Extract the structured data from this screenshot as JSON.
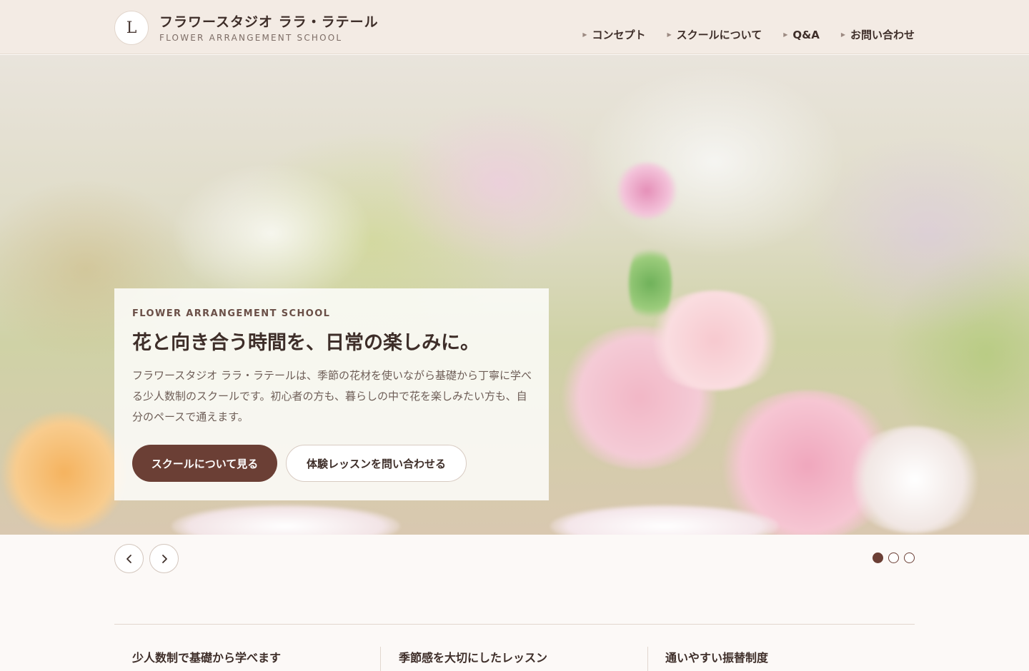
{
  "header": {
    "logo_letter": "L",
    "title": "フラワースタジオ ララ・ラテール",
    "subtitle": "FLOWER ARRANGEMENT SCHOOL",
    "nav": [
      {
        "label": "コンセプト"
      },
      {
        "label": "スクールについて"
      },
      {
        "label": "Q&A"
      },
      {
        "label": "お問い合わせ"
      }
    ]
  },
  "hero": {
    "eyebrow": "FLOWER ARRANGEMENT SCHOOL",
    "title": "花と向き合う時間を、日常の楽しみに。",
    "body": "フラワースタジオ ララ・ラテールは、季節の花材を使いながら基礎から丁寧に学べる少人数制のスクールです。初心者の方も、暮らしの中で花を楽しみたい方も、自分のペースで通えます。",
    "primary_button": "スクールについて見る",
    "secondary_button": "体験レッスンを問い合わせる"
  },
  "slider": {
    "prev_icon": "chevron-left-icon",
    "next_icon": "chevron-right-icon",
    "slide_count": 3,
    "active_index": 0
  },
  "features": [
    {
      "label": "少人数制で基礎から学べます"
    },
    {
      "label": "季節感を大切にしたレッスン"
    },
    {
      "label": "通いやすい振替制度"
    }
  ],
  "colors": {
    "header_bg": "#f3ebe4",
    "accent": "#6b3f35",
    "text": "#3e2e29",
    "page_bg": "#fcf9f7"
  }
}
